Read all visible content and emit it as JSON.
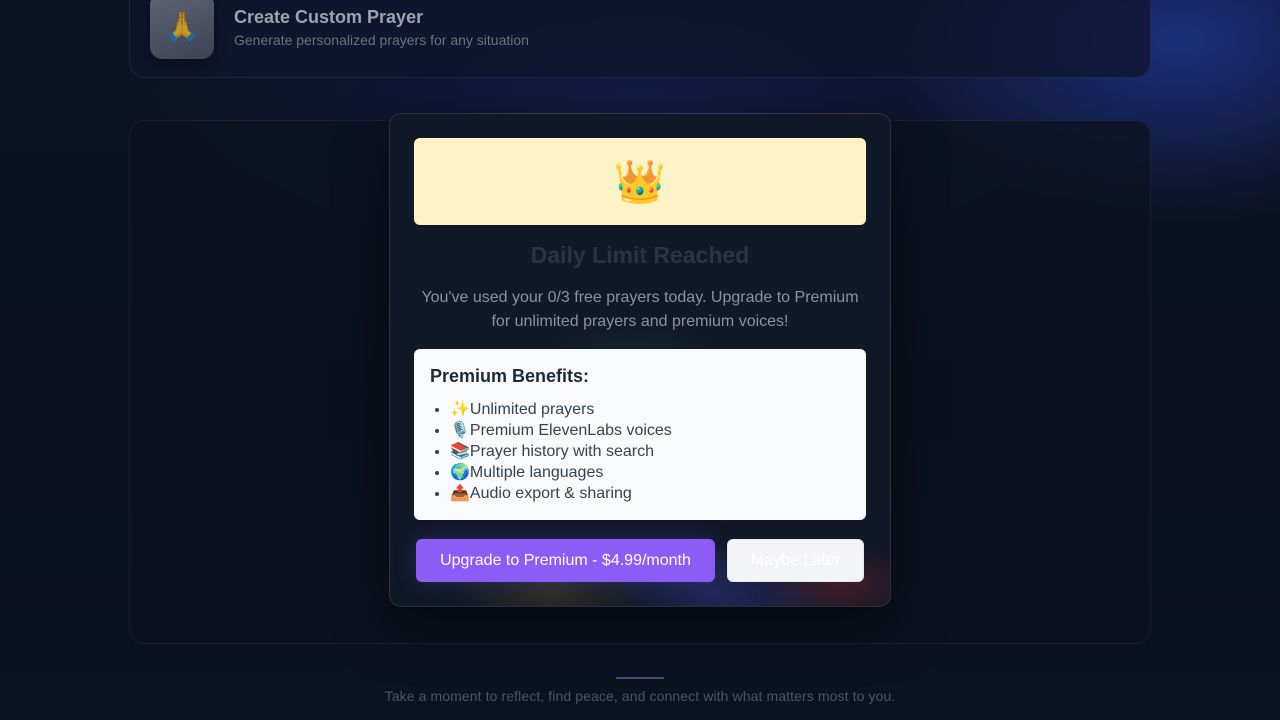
{
  "top_card": {
    "icon": "praying-hands-icon",
    "title": "Create Custom Prayer",
    "subtitle": "Generate personalized prayers for any situation"
  },
  "modal": {
    "banner_icon": "crown-icon",
    "banner_emoji": "👑",
    "title": "Daily Limit Reached",
    "message": "You've used your 0/3 free prayers today. Upgrade to Premium for unlimited prayers and premium voices!",
    "benefits": {
      "title": "Premium Benefits:",
      "items": [
        {
          "icon": "sparkles-icon",
          "emoji": "✨",
          "label": "Unlimited prayers"
        },
        {
          "icon": "microphone-icon",
          "emoji": "🎙️",
          "label": "Premium ElevenLabs voices"
        },
        {
          "icon": "books-icon",
          "emoji": "📚",
          "label": "Prayer history with search"
        },
        {
          "icon": "globe-icon",
          "emoji": "🌍",
          "label": "Multiple languages"
        },
        {
          "icon": "outbox-tray-icon",
          "emoji": "📤",
          "label": "Audio export & sharing"
        }
      ]
    },
    "upgrade_label": "Upgrade to Premium - $4.99/month",
    "later_label": "Maybe Later"
  },
  "footer": {
    "text": "Take a moment to reflect, find peace, and connect with what matters most to you."
  },
  "colors": {
    "accent": "#8b5cf6",
    "banner": "#fef3c7",
    "benefits_bg": "#f8fafc"
  }
}
